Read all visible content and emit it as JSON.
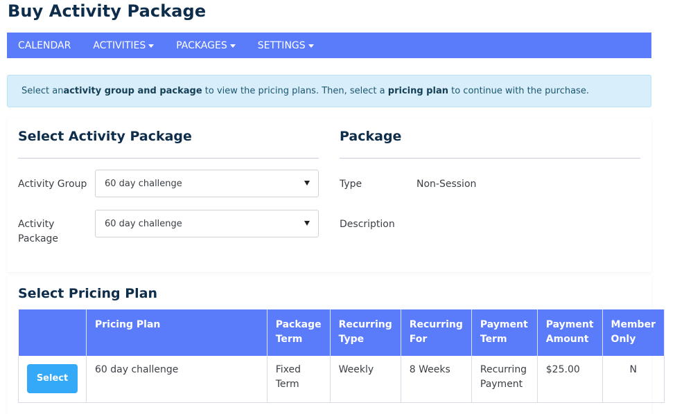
{
  "page": {
    "title": "Buy Activity Package"
  },
  "nav": {
    "items": [
      {
        "label": "CALENDAR",
        "dropdown": false
      },
      {
        "label": "ACTIVITIES",
        "dropdown": true
      },
      {
        "label": "PACKAGES",
        "dropdown": true
      },
      {
        "label": "SETTINGS",
        "dropdown": true
      }
    ]
  },
  "alert": {
    "t1": "Select an ",
    "b1": "activity group and package",
    "t2": " to view the pricing plans. Then, select a ",
    "b2": "pricing plan",
    "t3": " to continue with the purchase."
  },
  "select_package": {
    "title": "Select Activity Package",
    "activity_group_label": "Activity Group",
    "activity_group_value": "60 day challenge",
    "activity_package_label_1": "Activity",
    "activity_package_label_2": "Package",
    "activity_package_value": "60 day challenge"
  },
  "package": {
    "title": "Package",
    "type_label": "Type",
    "type_value": "Non-Session",
    "description_label": "Description",
    "description_value": ""
  },
  "pricing": {
    "title": "Select Pricing Plan",
    "headers": {
      "plan": "Pricing Plan",
      "term_1": "Package",
      "term_2": "Term",
      "rtype_1": "Recurring",
      "rtype_2": "Type",
      "rfor_1": "Recurring",
      "rfor_2": "For",
      "pterm_1": "Payment",
      "pterm_2": "Term",
      "pamt_1": "Payment",
      "pamt_2": "Amount",
      "member_1": "Member",
      "member_2": "Only"
    },
    "rows": [
      {
        "button": "Select",
        "plan": "60 day challenge",
        "term_1": "Fixed",
        "term_2": "Term",
        "rtype": "Weekly",
        "rfor": "8 Weeks",
        "pterm_1": "Recurring",
        "pterm_2": "Payment",
        "pamt": "$25.00",
        "member": "N"
      }
    ]
  },
  "colors": {
    "nav": "#5b7cfa",
    "title": "#0d2d4a",
    "alert_bg": "#d8eefb",
    "button": "#33a9f7"
  }
}
